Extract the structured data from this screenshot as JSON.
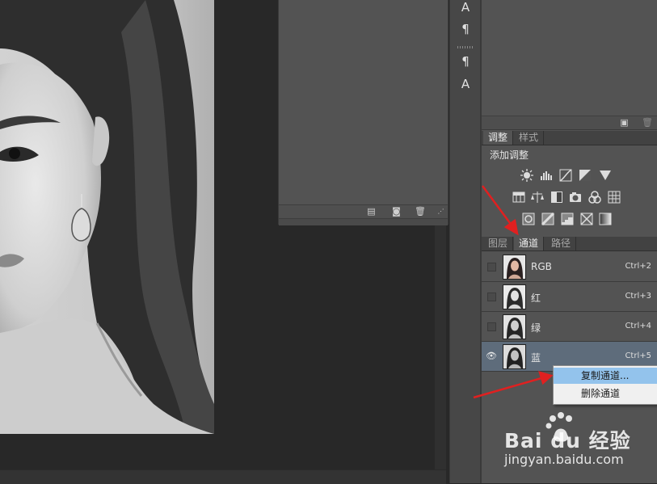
{
  "adjustments_panel": {
    "tabs": [
      {
        "label": "调整"
      },
      {
        "label": "样式"
      }
    ],
    "title": "添加调整"
  },
  "layers_panel": {
    "tabs": [
      {
        "label": "图层"
      },
      {
        "label": "通道"
      },
      {
        "label": "路径"
      }
    ],
    "active_tab": "通道"
  },
  "channels": [
    {
      "name": "RGB",
      "shortcut": "Ctrl+2",
      "visible": false,
      "selected": false
    },
    {
      "name": "红",
      "shortcut": "Ctrl+3",
      "visible": false,
      "selected": false
    },
    {
      "name": "绿",
      "shortcut": "Ctrl+4",
      "visible": false,
      "selected": false
    },
    {
      "name": "蓝",
      "shortcut": "Ctrl+5",
      "visible": true,
      "selected": true
    }
  ],
  "context_menu": {
    "items": [
      {
        "label": "复制通道..."
      },
      {
        "label": "删除通道"
      }
    ]
  },
  "tool_strip": {
    "items": [
      {
        "glyph": "A"
      },
      {
        "glyph": "¶"
      },
      {
        "glyph": "¶"
      },
      {
        "glyph": "A"
      }
    ]
  },
  "watermark": {
    "brand_text": "Bai du 经验",
    "url": "jingyan.baidu.com"
  },
  "colors": {
    "panel_bg": "#535353",
    "selected_row": "#5e6c7b",
    "menu_highlight": "#93c3ec",
    "arrow_red": "#e02020"
  }
}
